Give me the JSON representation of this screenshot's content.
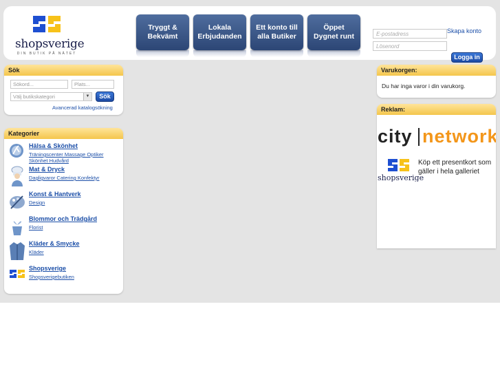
{
  "header": {
    "logo": {
      "word": "shopsverige",
      "tagline": "DIN BUTIK PÅ NÄTET"
    },
    "promos": [
      {
        "line1": "Tryggt &",
        "line2": "Bekvämt"
      },
      {
        "line1": "Lokala",
        "line2": "Erbjudanden"
      },
      {
        "line1": "Ett konto till",
        "line2": "alla Butiker"
      },
      {
        "line1": "Öppet",
        "line2": "Dygnet runt"
      }
    ],
    "login": {
      "email_placeholder": "E-postadress",
      "password_placeholder": "Lösenord",
      "create_account": "Skapa konto",
      "login_button": "Logga in"
    }
  },
  "search": {
    "title": "Sök",
    "what_placeholder": "Sökord...",
    "where_placeholder": "Plats...",
    "category_select": "Välj butikskategori",
    "button": "Sök",
    "advanced_link": "Avancerad katalogsökning"
  },
  "categories": {
    "title": "Kategorier",
    "items": [
      {
        "title": "Hälsa & Skönhet",
        "sub": "Träningscenter Massage Optiker Skönhet Hudvård"
      },
      {
        "title": "Mat & Dryck",
        "sub": "Dagligvaror Catering Konfektyr"
      },
      {
        "title": "Konst & Hantverk",
        "sub": "Design"
      },
      {
        "title": "Blommor och Trädgård",
        "sub": "Florist"
      },
      {
        "title": "Kläder & Smycke",
        "sub": "Kläder"
      },
      {
        "title": "Shopsverige",
        "sub": "Shopsverigebutiken"
      }
    ]
  },
  "cart": {
    "title": "Varukorgen:",
    "empty_text": "Du har inga varor i din varukorg."
  },
  "ads": {
    "title": "Reklam:",
    "citynetwork": {
      "city": "city",
      "network": "network"
    },
    "giftcard_text": "Köp ett presentkort som gäller i hela galleriet",
    "logo_word": "shopsverige"
  },
  "colors": {
    "accent_yellow": "#f4c64c",
    "link_blue": "#1c4fa8",
    "button_blue": "#1c4aa4",
    "logo_blue": "#1e4fd1",
    "logo_yellow": "#f7c21a",
    "background": "#e4e4e4"
  }
}
